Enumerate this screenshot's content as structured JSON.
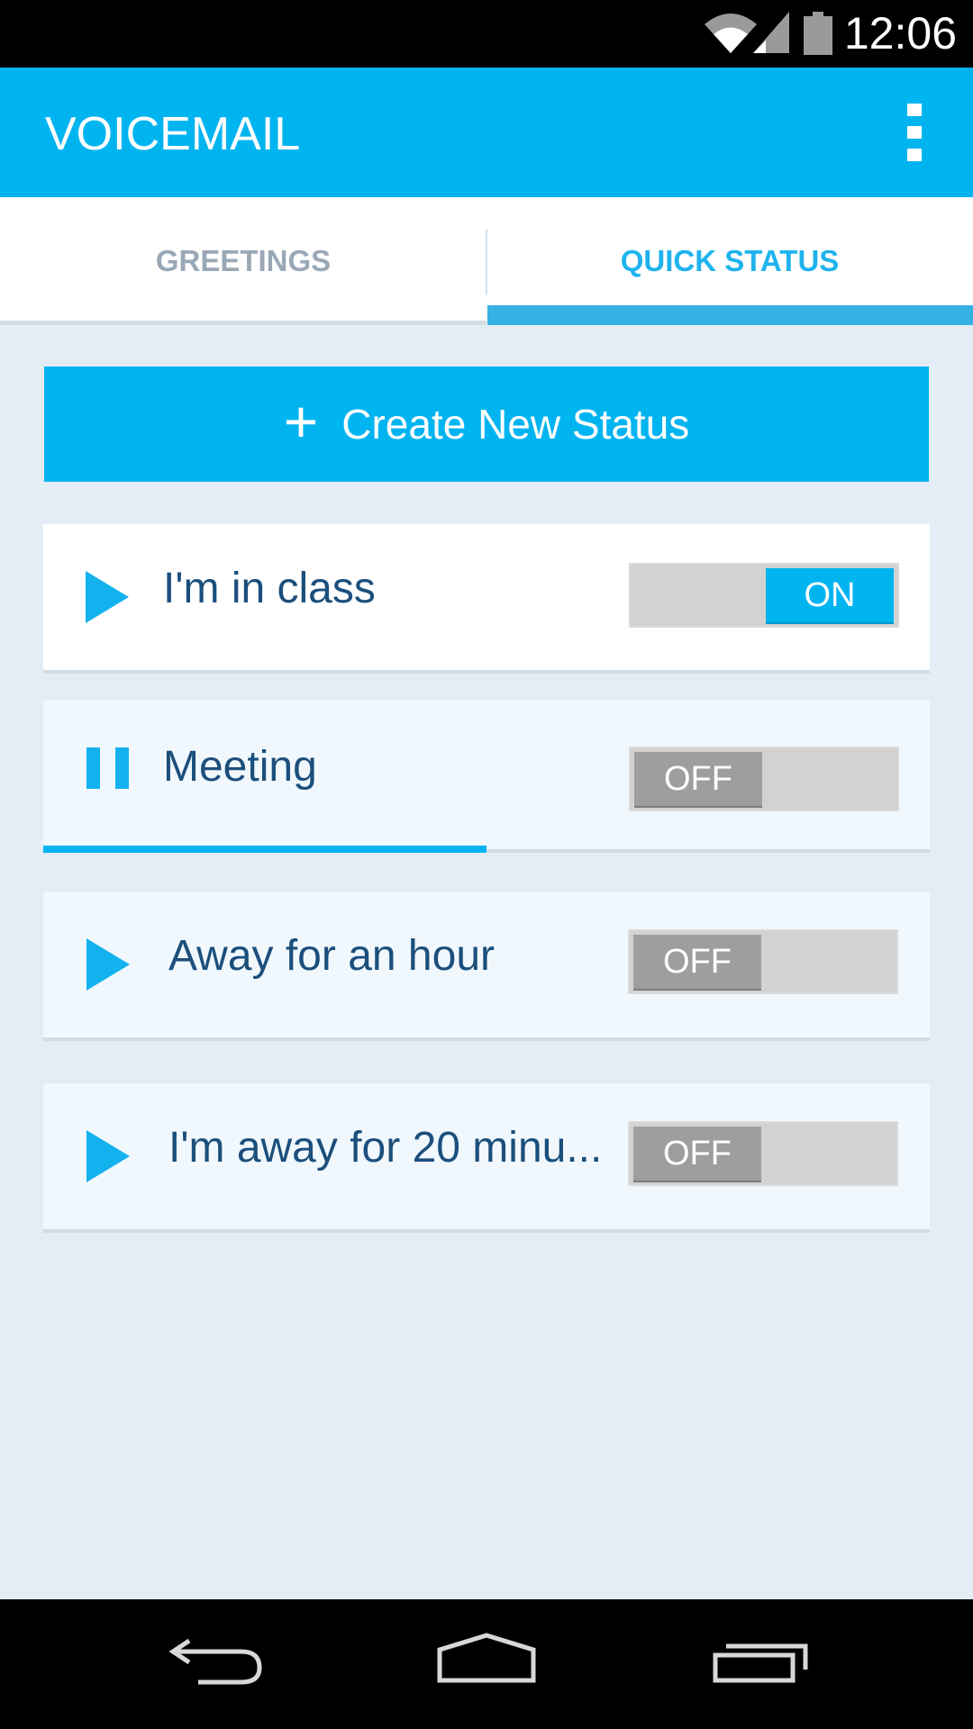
{
  "status_bar": {
    "time": "12:06"
  },
  "app_bar": {
    "title": "VOICEMAIL"
  },
  "tabs": [
    {
      "label": "GREETINGS",
      "selected": false
    },
    {
      "label": "QUICK STATUS",
      "selected": true
    }
  ],
  "create_button": {
    "icon": "plus-icon",
    "label": "Create New Status"
  },
  "statuses": [
    {
      "label": "I'm in class",
      "playback": "play",
      "toggle": "ON",
      "on": true
    },
    {
      "label": "Meeting",
      "playback": "pause",
      "toggle": "OFF",
      "on": false,
      "progress": 0.5
    },
    {
      "label": "Away for an hour",
      "playback": "play",
      "toggle": "OFF",
      "on": false
    },
    {
      "label": "I'm away for 20 minu...",
      "playback": "play",
      "toggle": "OFF",
      "on": false
    }
  ],
  "colors": {
    "accent": "#00b4f0",
    "text_dark": "#1b4f7c",
    "background": "#e4edf5",
    "toggle_off": "#9e9e9e"
  }
}
